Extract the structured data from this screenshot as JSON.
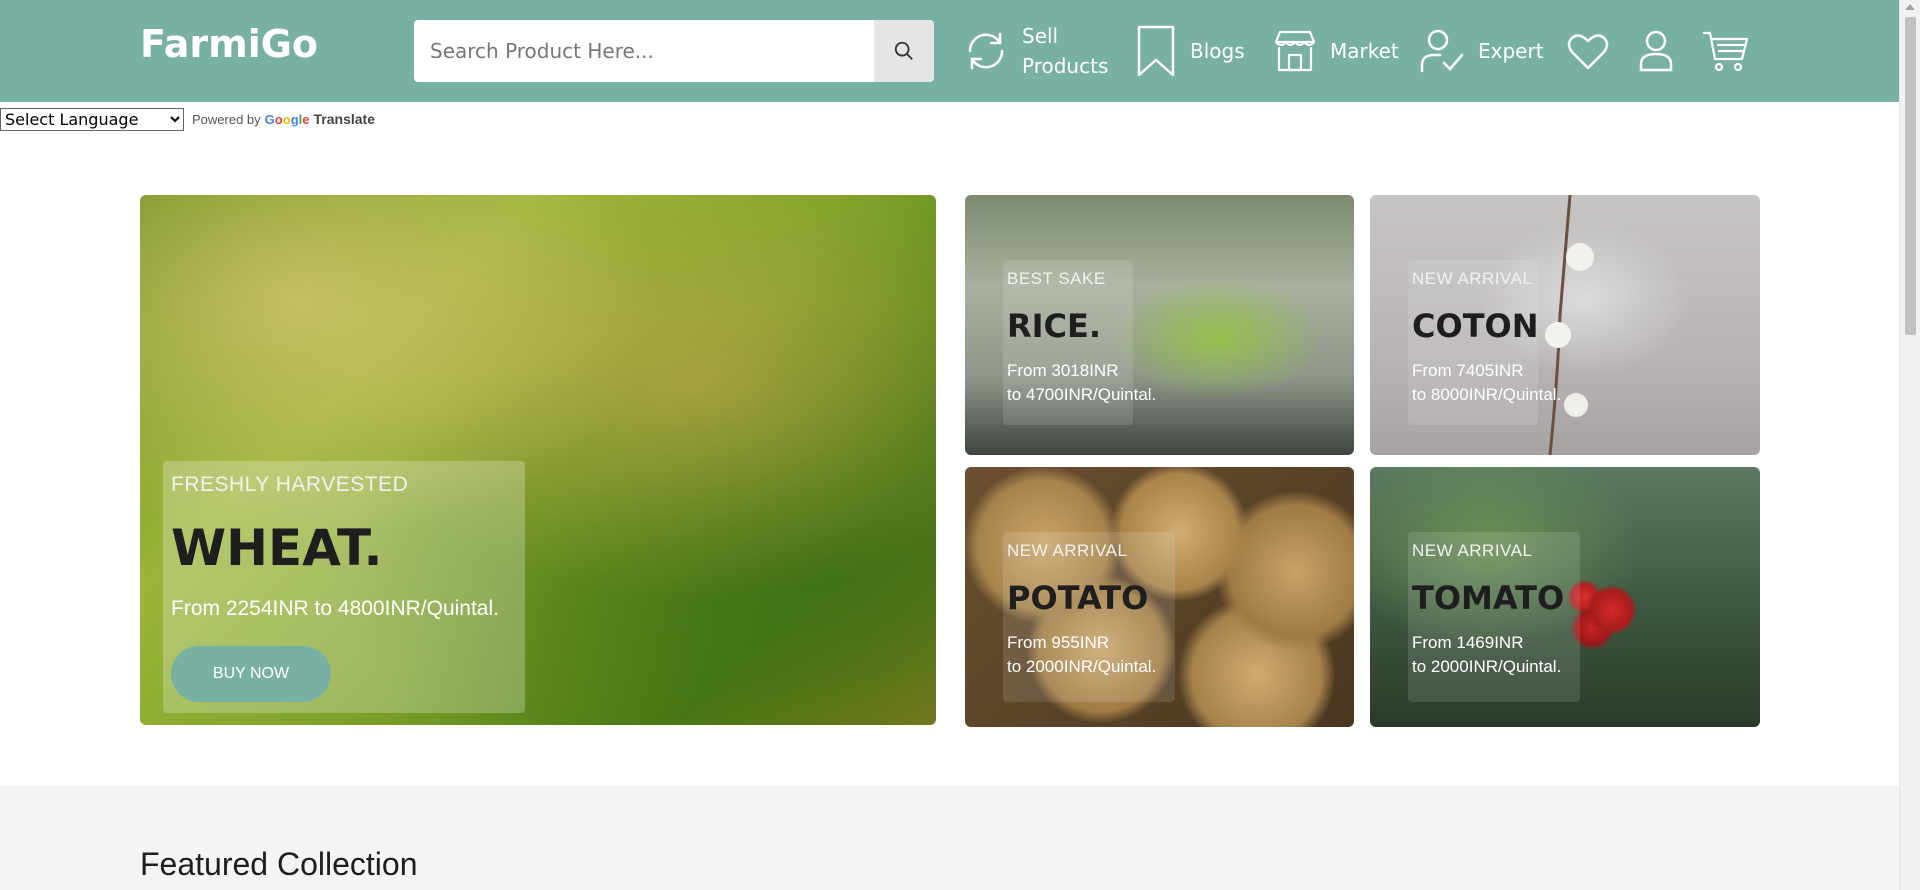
{
  "header": {
    "logo": "FarmiGo",
    "search_placeholder": "Search Product Here...",
    "nav": {
      "sell_line1": "Sell",
      "sell_line2": "Products",
      "blogs": "Blogs",
      "market": "Market",
      "expert": "Expert"
    },
    "icons": [
      "search-icon",
      "refresh-icon",
      "bookmark-icon",
      "store-icon",
      "user-check-icon",
      "heart-icon",
      "user-icon",
      "cart-icon"
    ]
  },
  "translate": {
    "select_label": "Select Language",
    "powered_by": "Powered by",
    "google": [
      "G",
      "o",
      "o",
      "g",
      "l",
      "e"
    ],
    "translate": "Translate"
  },
  "hero": {
    "main": {
      "kicker": "FRESHLY HARVESTED",
      "title": "WHEAT.",
      "price": "From 2254INR to 4800INR/Quintal.",
      "button": "BUY NOW"
    },
    "cards": [
      {
        "kicker": "BEST SAKE",
        "title": "RICE.",
        "price_line1": "From 3018INR",
        "price_line2": "to 4700INR/Quintal."
      },
      {
        "kicker": "NEW ARRIVAL",
        "title": "COTON",
        "price_line1": "From 7405INR",
        "price_line2": "to 8000INR/Quintal."
      },
      {
        "kicker": "NEW ARRIVAL",
        "title": "POTATO",
        "price_line1": "From 955INR",
        "price_line2": "to 2000INR/Quintal."
      },
      {
        "kicker": "NEW ARRIVAL",
        "title": "TOMATO",
        "price_line1": "From 1469INR",
        "price_line2": "to 2000INR/Quintal."
      }
    ]
  },
  "featured": {
    "title": "Featured Collection"
  },
  "colors": {
    "brand": "#78b0a4",
    "section_bg": "#f3f4f6"
  }
}
